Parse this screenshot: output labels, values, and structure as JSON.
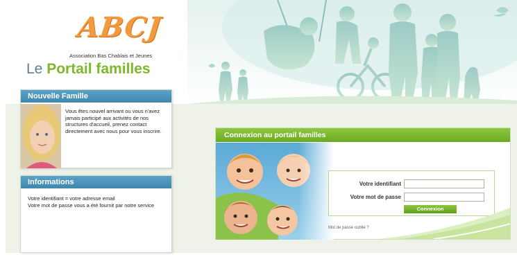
{
  "brand": {
    "logo": "ABCJ",
    "association": "Association Bas Chablais et Jeunes",
    "title_prefix": "Le",
    "title_main": "Portail familles"
  },
  "nouvelle_famille": {
    "title": "Nouvelle Famille",
    "text": "Vous êtes nouvel arrivant ou vous n'avez jamais participé aux activités de nos structures d'accueil, prenez contact directement avec nous pour vous inscrire."
  },
  "informations": {
    "title": "Informations",
    "line1": "Votre identifiant = votre adresse email",
    "line2": "Votre mot de passe vous a été fournit par notre service"
  },
  "login": {
    "title": "Connexion au portail familles",
    "identifiant_label": "Votre identifiant",
    "identifiant_value": "",
    "password_label": "Votre mot de passe",
    "password_value": "",
    "submit_label": "Connexion",
    "forgot_label": "Mot de passe oublié ?"
  },
  "colors": {
    "accent_green": "#7bb82c",
    "header_blue": "#4a93b9",
    "logo_orange": "#f39a3c"
  }
}
